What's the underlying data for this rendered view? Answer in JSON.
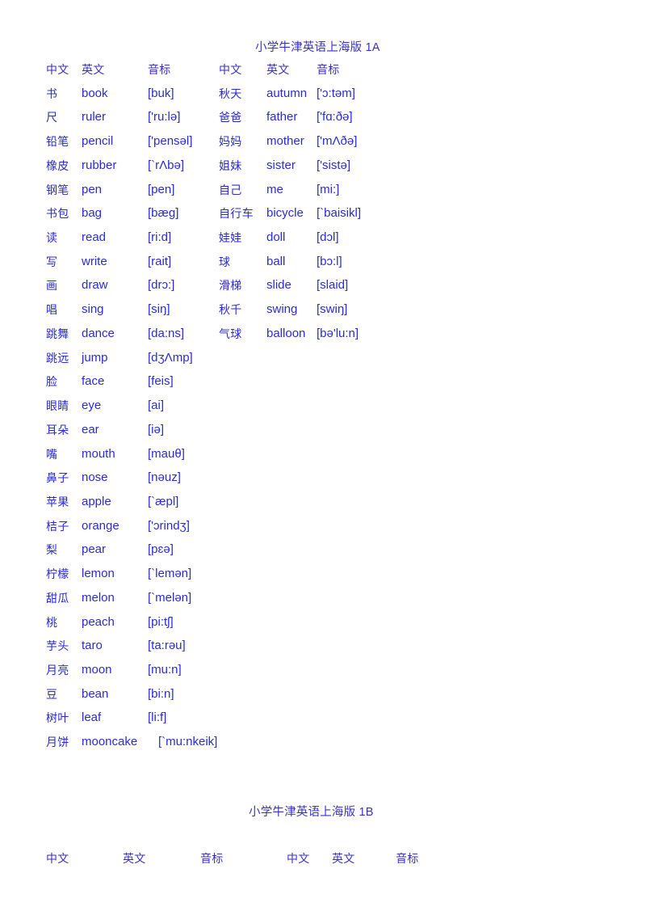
{
  "document": {
    "text_color": "#2b2bd4",
    "background_color": "#ffffff"
  },
  "sections": [
    {
      "id": "1A",
      "title": "小学牛津英语上海版 1A",
      "headers": {
        "chinese": "中文",
        "english": "英文",
        "phonetic": "音标"
      },
      "left_column": [
        {
          "chinese": "书",
          "english": "book",
          "phonetic": "[buk]"
        },
        {
          "chinese": "尺",
          "english": "ruler",
          "phonetic": "['ru:lə]"
        },
        {
          "chinese": "铅笔",
          "english": "pencil",
          "phonetic": "['pensəl]"
        },
        {
          "chinese": "橡皮",
          "english": "rubber",
          "phonetic": "[`rΛbə]"
        },
        {
          "chinese": "钢笔",
          "english": "pen",
          "phonetic": "[pen]"
        },
        {
          "chinese": "书包",
          "english": "bag",
          "phonetic": "[bæg]"
        },
        {
          "chinese": "读",
          "english": "read",
          "phonetic": "[ri:d]"
        },
        {
          "chinese": "写",
          "english": "write",
          "phonetic": "[rait]"
        },
        {
          "chinese": "画",
          "english": "draw",
          "phonetic": "[drɔ:]"
        },
        {
          "chinese": "唱",
          "english": "sing",
          "phonetic": "[siŋ]"
        },
        {
          "chinese": "跳舞",
          "english": "dance",
          "phonetic": "[da:ns]"
        },
        {
          "chinese": "跳远",
          "english": "jump",
          "phonetic": "[dʒΛmp]"
        },
        {
          "chinese": "脸",
          "english": "face",
          "phonetic": "[feis]"
        },
        {
          "chinese": "眼睛",
          "english": "eye",
          "phonetic": "[ai]"
        },
        {
          "chinese": "耳朵",
          "english": "ear",
          "phonetic": "[iə]"
        },
        {
          "chinese": "嘴",
          "english": "mouth",
          "phonetic": "[mauθ]"
        },
        {
          "chinese": "鼻子",
          "english": "nose",
          "phonetic": "[nəuz]"
        },
        {
          "chinese": "苹果",
          "english": "apple",
          "phonetic": "[`æpl]"
        },
        {
          "chinese": "桔子",
          "english": "orange",
          "phonetic": "['ɔrindʒ]"
        },
        {
          "chinese": "梨",
          "english": "pear",
          "phonetic": "[pɛə]"
        },
        {
          "chinese": "柠檬",
          "english": "lemon",
          "phonetic": "[`lemən]"
        },
        {
          "chinese": "甜瓜",
          "english": "melon",
          "phonetic": "[`melən]"
        },
        {
          "chinese": "桃",
          "english": "peach",
          "phonetic": "[pi:tʃ]"
        },
        {
          "chinese": "芋头",
          "english": "taro",
          "phonetic": "[ta:rəu]"
        },
        {
          "chinese": "月亮",
          "english": "moon",
          "phonetic": "[mu:n]"
        },
        {
          "chinese": "豆",
          "english": "bean",
          "phonetic": "[bi:n]"
        },
        {
          "chinese": "树叶",
          "english": "leaf",
          "phonetic": "[li:f]"
        },
        {
          "chinese": "月饼",
          "english": "mooncake",
          "phonetic": "[`mu:nkeik]"
        }
      ],
      "right_column": [
        {
          "chinese": "秋天",
          "english": "autumn",
          "phonetic": "['ɔ:təm]"
        },
        {
          "chinese": "爸爸",
          "english": "father",
          "phonetic": "['fɑ:ðə]"
        },
        {
          "chinese": "妈妈",
          "english": "mother",
          "phonetic": "['mΛðə]"
        },
        {
          "chinese": "姐妹",
          "english": "sister",
          "phonetic": "['sistə]"
        },
        {
          "chinese": "自己",
          "english": "me",
          "phonetic": "[mi:]"
        },
        {
          "chinese": "自行车",
          "english": "bicycle",
          "phonetic": "[`baisikl]"
        },
        {
          "chinese": "娃娃",
          "english": "doll",
          "phonetic": "[dɔl]"
        },
        {
          "chinese": "球",
          "english": "ball",
          "phonetic": "[bɔ:l]"
        },
        {
          "chinese": "滑梯",
          "english": "slide",
          "phonetic": "[slaid]"
        },
        {
          "chinese": "秋千",
          "english": "swing",
          "phonetic": "[swiŋ]"
        },
        {
          "chinese": "气球",
          "english": "balloon",
          "phonetic": "[bə'lu:n]"
        }
      ]
    },
    {
      "id": "1B",
      "title": "小学牛津英语上海版 1B",
      "headers": {
        "chinese": "中文",
        "english": "英文",
        "phonetic": "音标"
      }
    }
  ]
}
